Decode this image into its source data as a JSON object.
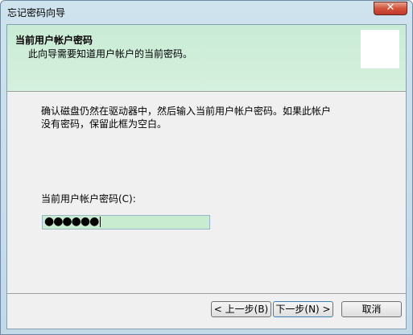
{
  "window": {
    "title": "忘记密码向导",
    "close_glyph": "✕"
  },
  "header": {
    "title": "当前用户帐户密码",
    "subtitle": "此向导需要知道用户帐户的当前密码。"
  },
  "body": {
    "description": "确认磁盘仍然在驱动器中，然后输入当前用户帐户密码。如果此帐户没有密码，保留此框为空白。",
    "password_label": "当前用户帐户密码(C):",
    "password_value": "●●●●●●"
  },
  "buttons": {
    "back": "< 上一步(B)",
    "next": "下一步(N) >",
    "cancel": "取消"
  }
}
